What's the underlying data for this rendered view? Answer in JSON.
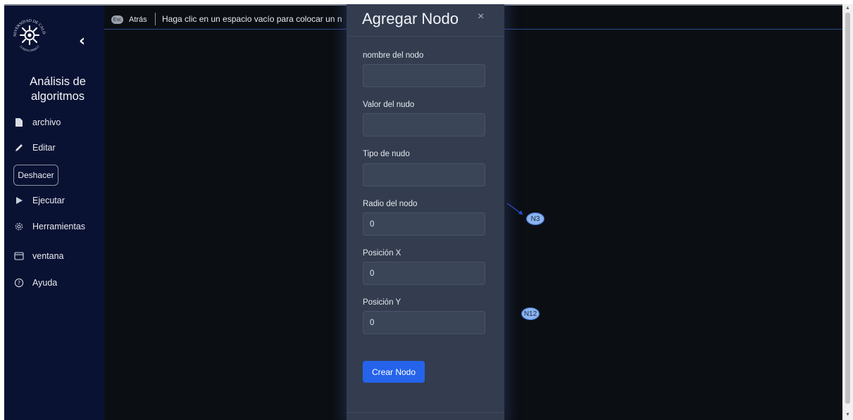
{
  "sidebar": {
    "title": "Análisis de algoritmos",
    "logo": {
      "ring_text": "UNIVERSIDAD DE CALDAS",
      "motto": "LUMINA SPARGO"
    },
    "items": [
      {
        "label": "archivo",
        "icon": "file-icon"
      },
      {
        "label": "Editar",
        "icon": "pencil-icon"
      },
      {
        "label": "Ejecutar",
        "icon": "play-icon"
      },
      {
        "label": "Herramientas",
        "icon": "gear-icon"
      },
      {
        "label": "ventana",
        "icon": "window-icon"
      },
      {
        "label": "Ayuda",
        "icon": "help-icon"
      }
    ],
    "undo_label": "Deshacer"
  },
  "toolbar": {
    "back_badge": "Esc",
    "back_label": "Atrás",
    "hint": "Haga clic en un espacio vacío para colocar un nue"
  },
  "canvas": {
    "nodes": [
      {
        "label": "N3"
      },
      {
        "label": "N12"
      }
    ],
    "edge_color": "#2f4fd8",
    "node_fill": "#8ab4f0"
  },
  "modal": {
    "title": "Agregar Nodo",
    "close_icon": "×",
    "fields": [
      {
        "label": "nombre del nodo",
        "value": ""
      },
      {
        "label": "Valor del nudo",
        "value": ""
      },
      {
        "label": "Tipo de nudo",
        "value": ""
      },
      {
        "label": "Radio del nodo",
        "value": "0"
      },
      {
        "label": "Posición X",
        "value": "0"
      },
      {
        "label": "Posición Y",
        "value": "0"
      }
    ],
    "submit_label": "Crear Nodo",
    "accent": "#2563eb"
  },
  "colors": {
    "sidebar_bg": "#0a1233",
    "canvas_bg": "#0b0f14",
    "modal_bg": "#333d4f"
  }
}
